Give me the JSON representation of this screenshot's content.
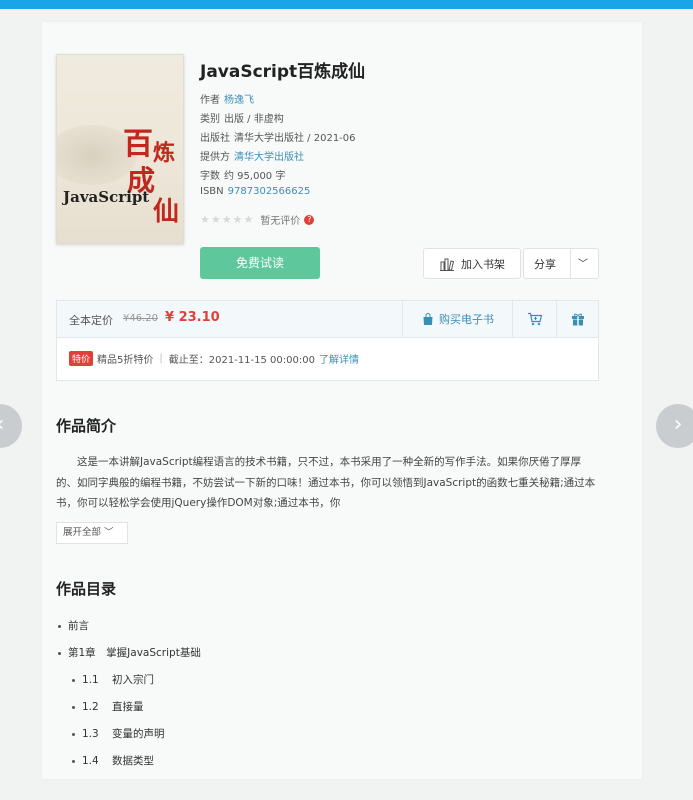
{
  "book": {
    "title": "JavaScript百炼成仙",
    "author_label": "作者",
    "author": "杨逸飞",
    "category_label": "类别",
    "category": "出版 / 非虚构",
    "publisher_label": "出版社",
    "publisher": "清华大学出版社 / 2021-06",
    "provider_label": "提供方",
    "provider": "清华大学出版社",
    "wordcount_label": "字数",
    "wordcount": "约 95,000 字",
    "isbn_label": "ISBN",
    "isbn": "9787302566625",
    "rating_text": "暂无评价"
  },
  "cover": {
    "title_cjk": [
      "百",
      "炼",
      "成",
      "仙"
    ],
    "title_latin": "JavaScript"
  },
  "actions": {
    "trial": "免费试读",
    "add_shelf": "加入书架",
    "share": "分享"
  },
  "price": {
    "label": "全本定价",
    "original": "¥46.20",
    "current": "¥ 23.10",
    "buy_ebook": "购买电子书",
    "promo_badge": "特价",
    "promo_text": "精品5折特价",
    "deadline": "截止至：2021-11-15 00:00:00",
    "detail_link": "了解详情"
  },
  "intro": {
    "heading": "作品简介",
    "text": "这是一本讲解JavaScript编程语言的技术书籍，只不过，本书采用了一种全新的写作手法。如果你厌倦了厚厚的、如同字典般的编程书籍，不妨尝试一下新的口味！通过本书，你可以领悟到JavaScript的函数七重关秘籍;通过本书，你可以轻松学会使用jQuery操作DOM对象;通过本书，你",
    "expand": "展开全部 ﹀"
  },
  "toc": {
    "heading": "作品目录",
    "items": [
      {
        "num": "",
        "title": "前言"
      },
      {
        "num": "",
        "title": "第1章　掌握JavaScript基础"
      },
      {
        "num": "1.1",
        "title": "初入宗门"
      },
      {
        "num": "1.2",
        "title": "直接量"
      },
      {
        "num": "1.3",
        "title": "变量的声明"
      },
      {
        "num": "1.4",
        "title": "数据类型"
      }
    ]
  },
  "colors": {
    "accent_green": "#5fc79c",
    "price_red": "#e0403a",
    "link_blue": "#3a8fb5",
    "top_bar": "#1aa5e8"
  },
  "icons": [
    "shelf-icon",
    "chevron-down-icon",
    "bag-icon",
    "cart-icon",
    "gift-icon",
    "chevron-left-icon",
    "chevron-right-icon",
    "question-icon",
    "star-icon"
  ]
}
